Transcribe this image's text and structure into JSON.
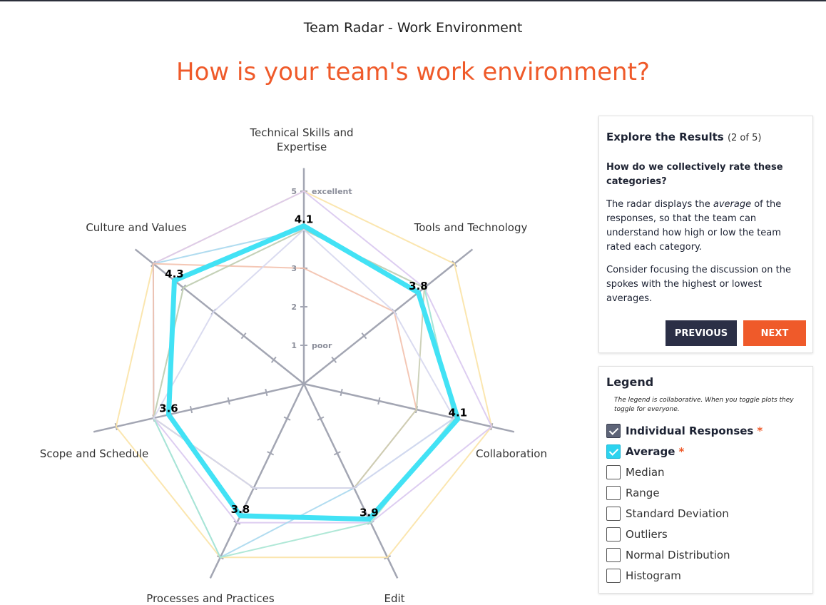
{
  "header": {
    "subtitle": "Team Radar - Work Environment",
    "title": "How is your team's work environment?"
  },
  "chart_data": {
    "type": "radar",
    "categories": [
      "Technical Skills and Expertise",
      "Tools and Technology",
      "Collaboration",
      "Edit",
      "Processes and Practices",
      "Scope and Schedule",
      "Culture and Values"
    ],
    "scale_labels": [
      {
        "value": 5,
        "text": "5",
        "desc": "excellent"
      },
      {
        "value": 3,
        "text": "3",
        "desc": ""
      },
      {
        "value": 2,
        "text": "2",
        "desc": ""
      },
      {
        "value": 1,
        "text": "1",
        "desc": "poor"
      }
    ],
    "range": [
      0,
      5
    ],
    "average": {
      "name": "Average",
      "values": [
        4.1,
        3.8,
        4.1,
        3.9,
        3.8,
        3.6,
        4.3
      ],
      "labels": [
        "4.1",
        "3.8",
        "4.1",
        "3.9",
        "3.8",
        "3.6",
        "4.3"
      ],
      "color": "#42e2f5"
    },
    "individuals": [
      {
        "color": "#fbe3a6",
        "values": [
          5,
          5,
          5,
          5,
          5,
          5,
          5
        ]
      },
      {
        "color": "#d9c8ef",
        "values": [
          5,
          4,
          5,
          4,
          4,
          4,
          5
        ]
      },
      {
        "color": "#a9d8ee",
        "values": [
          4,
          4,
          4,
          3,
          5,
          4,
          5
        ]
      },
      {
        "color": "#a7e6d3",
        "values": [
          4,
          4,
          4,
          4,
          5,
          4,
          4
        ]
      },
      {
        "color": "#f3c1ad",
        "values": [
          3,
          3,
          3,
          3,
          3,
          4,
          5
        ]
      },
      {
        "color": "#c9cdb3",
        "values": [
          4,
          4,
          3,
          3,
          3,
          4,
          4
        ]
      },
      {
        "color": "#d6d7ee",
        "values": [
          4,
          3,
          4,
          3,
          3,
          4,
          3
        ]
      }
    ]
  },
  "explore": {
    "heading": "Explore the Results",
    "count": "(2 of 5)",
    "question": "How do we collectively rate these categories?",
    "p1_pre": "The radar displays the ",
    "p1_em": "average",
    "p1_post": " of the responses, so that the team can understand how high or low the team rated each category.",
    "p2": "Consider focusing the discussion on the spokes with the highest or lowest averages.",
    "prev_label": "PREVIOUS",
    "next_label": "NEXT"
  },
  "legend": {
    "heading": "Legend",
    "note": "The legend is collaborative. When you toggle plots they toggle for everyone.",
    "items": [
      {
        "label": "Individual Responses",
        "checked": true,
        "required": "*"
      },
      {
        "label": "Average",
        "checked": true,
        "required": "*"
      },
      {
        "label": "Median",
        "checked": false
      },
      {
        "label": "Range",
        "checked": false
      },
      {
        "label": "Standard Deviation",
        "checked": false
      },
      {
        "label": "Outliers",
        "checked": false
      },
      {
        "label": "Normal Distribution",
        "checked": false
      },
      {
        "label": "Histogram",
        "checked": false
      }
    ]
  }
}
